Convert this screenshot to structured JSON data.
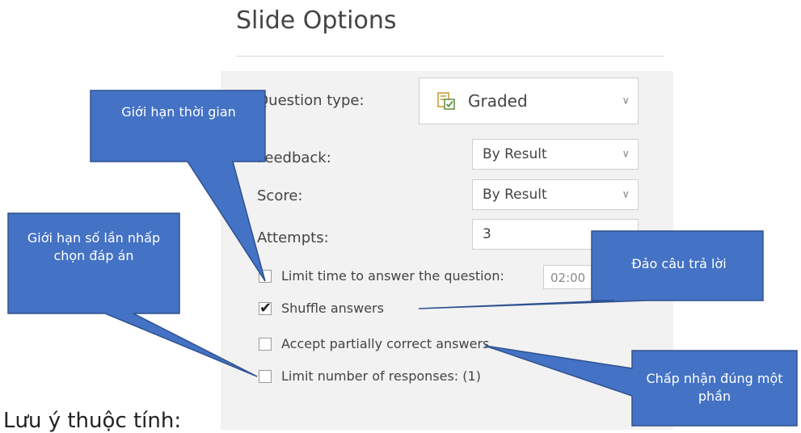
{
  "panel": {
    "title": "Slide Options",
    "question_type": {
      "label": "Question type:",
      "value": "Graded"
    },
    "feedback": {
      "label": "Feedback:",
      "value": "By Result"
    },
    "score": {
      "label": "Score:",
      "value": "By Result"
    },
    "attempts": {
      "label": "Attempts:",
      "value": "3"
    },
    "options": [
      {
        "label": "Limit time to answer the question:",
        "checked": false
      },
      {
        "label": "Shuffle answers",
        "checked": true
      },
      {
        "label": "Accept partially correct answers",
        "checked": false
      },
      {
        "label": "Limit number of responses: (1)",
        "checked": false
      }
    ],
    "time_value": "02:00"
  },
  "callouts": {
    "time_limit": "Giới hạn thời gian",
    "attempts_limit": "Giới hạn số lần nhấp chọn đáp án",
    "shuffle": "Đảo câu trả lời",
    "partial": "Chấp nhận đúng một phần"
  },
  "bottom_text": "Lưu ý thuộc tính:",
  "colors": {
    "callout_fill": "#4472c4",
    "callout_stroke": "#2f528f"
  },
  "icons": {
    "graded": "graded-checklist-icon",
    "chevron": "chevron-down-icon",
    "check": "check-icon"
  }
}
